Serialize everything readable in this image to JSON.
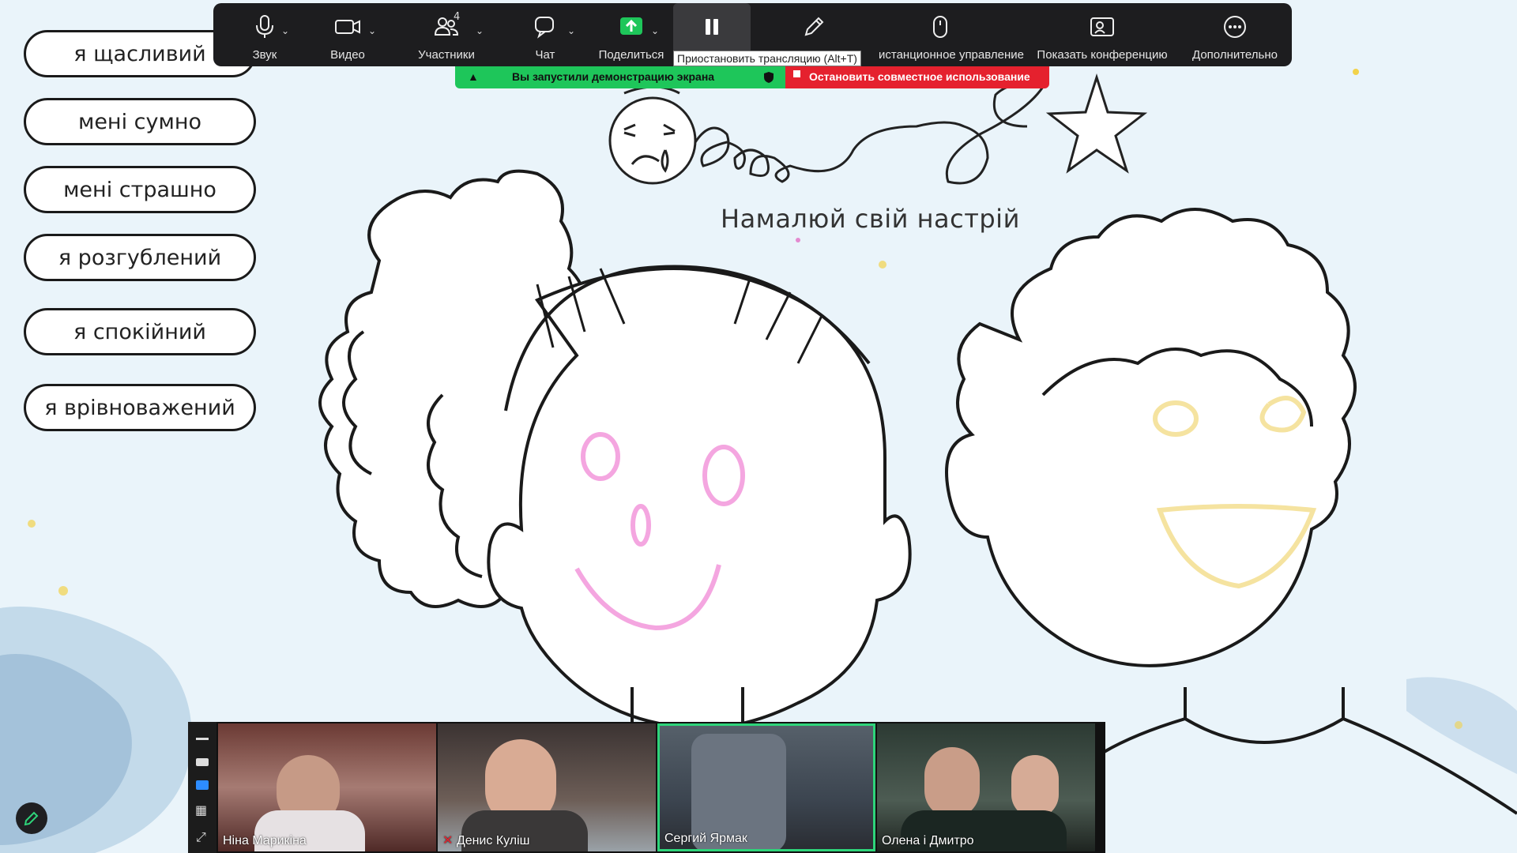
{
  "mood_options": [
    "я щасливий",
    "мені сумно",
    "мені страшно",
    "я розгублений",
    "я спокійний",
    "я врівноважений"
  ],
  "slide": {
    "title": "Намалюй свій настрій"
  },
  "toolbar": {
    "audio": "Звук",
    "video": "Видео",
    "participants": "Участники",
    "participants_count": "4",
    "chat": "Чат",
    "share": "Поделиться",
    "pause_tooltip": "Приостановить трансляцию (Alt+T)",
    "remote_control": "истанционное управление",
    "show_conference": "Показать конференцию",
    "more": "Дополнительно"
  },
  "share_status": {
    "message": "Вы запустили демонстрацию экрана",
    "stop": "Остановить совместное использование"
  },
  "participants": [
    {
      "name": "Ніна Марикіна"
    },
    {
      "name": "Денис Куліш"
    },
    {
      "name": "Сергий Ярмак"
    },
    {
      "name": "Олена і Дмитро"
    }
  ],
  "colors": {
    "toolbar_bg": "#1d1d1f",
    "share_green": "#1ec65a",
    "stop_red": "#e5212e",
    "active_speaker": "#2ed47a",
    "drawing_pink": "#f4a6e0",
    "drawing_yellow": "#f5e3a0"
  }
}
